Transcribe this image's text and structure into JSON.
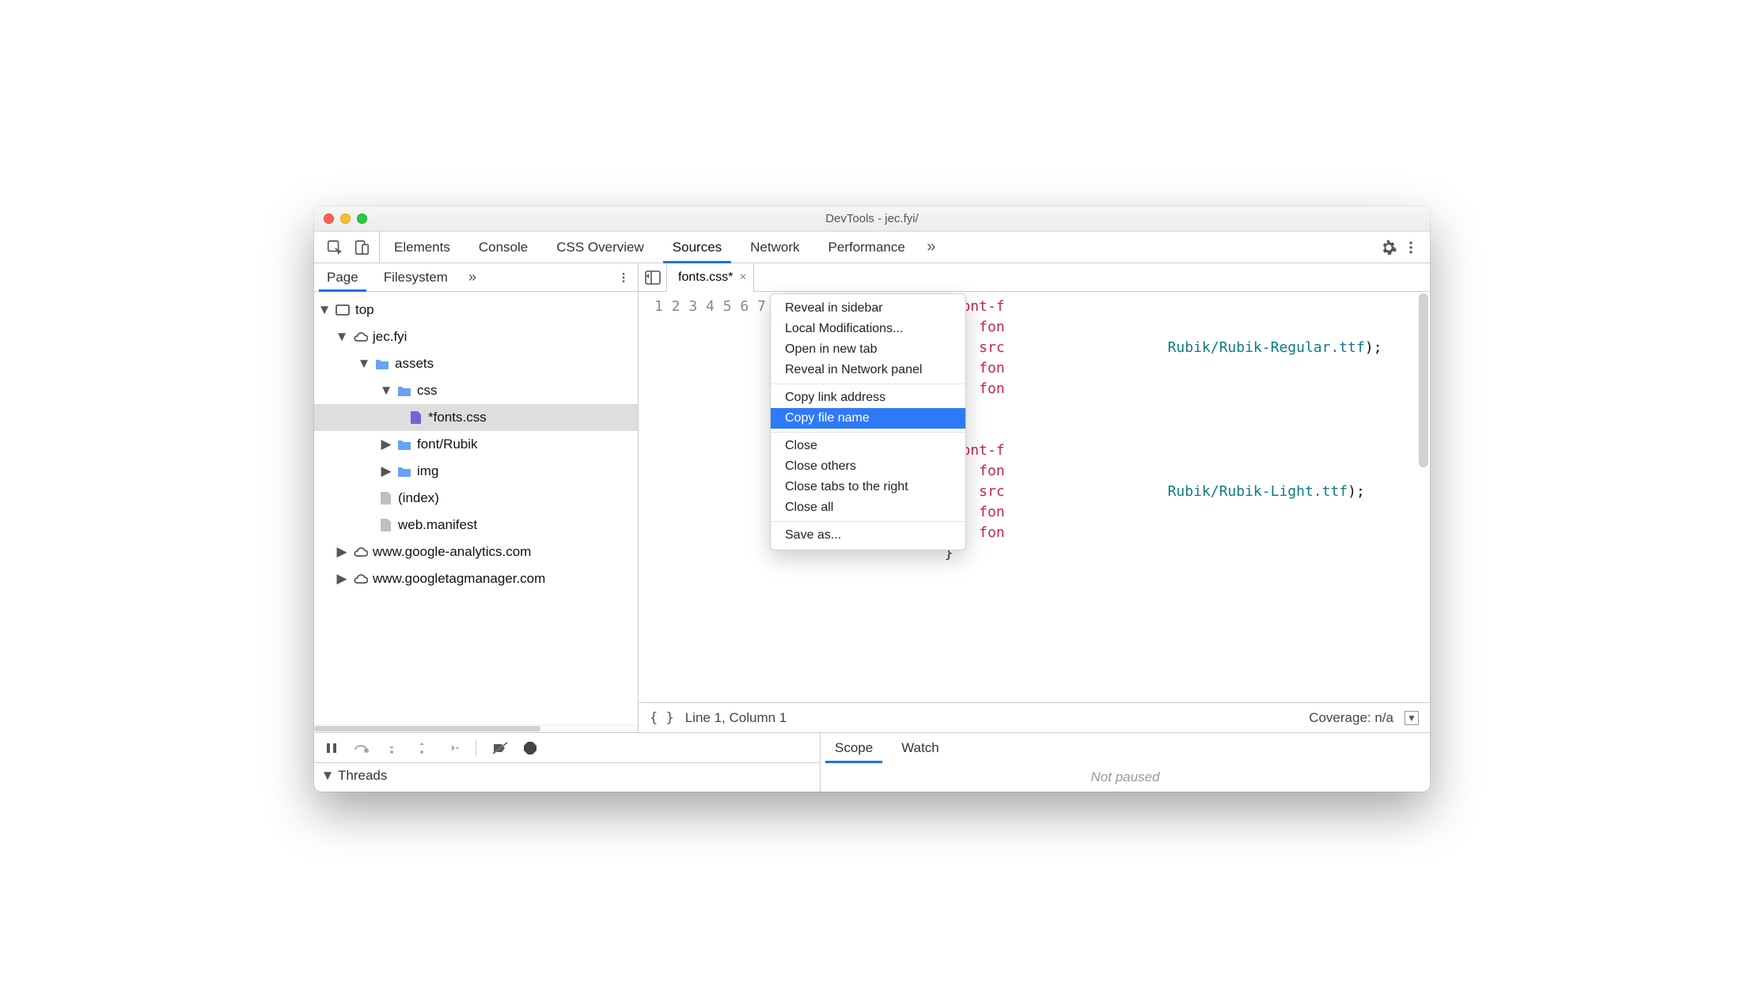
{
  "window": {
    "title": "DevTools - jec.fyi/"
  },
  "toolbar": {
    "tabs": [
      "Elements",
      "Console",
      "CSS Overview",
      "Sources",
      "Network",
      "Performance"
    ],
    "active": "Sources",
    "more": "»"
  },
  "sidebar": {
    "tabs": [
      "Page",
      "Filesystem"
    ],
    "active": "Page",
    "more": "»",
    "tree": {
      "top": "top",
      "domain": "jec.fyi",
      "folders": {
        "assets": "assets",
        "css": "css",
        "font": "font/Rubik",
        "img": "img"
      },
      "files": {
        "fonts_css": "*fonts.css",
        "index": "(index)",
        "manifest": "web.manifest"
      },
      "ext_domains": [
        "www.google-analytics.com",
        "www.googletagmanager.com"
      ]
    }
  },
  "editor": {
    "tab": "fonts.css*",
    "lines": [
      {
        "pre": "",
        "cls": "tok-atrule",
        "txt": "@font-f",
        "tail": ""
      },
      {
        "pre": "    ",
        "cls": "tok-prop",
        "txt": "fon",
        "tail": ""
      },
      {
        "pre": "    ",
        "cls": "tok-prop",
        "txt": "src",
        "tail_url": "Rubik/Rubik-Regular.ttf",
        "tail_close": ");"
      },
      {
        "pre": "    ",
        "cls": "tok-prop",
        "txt": "fon",
        "tail": ""
      },
      {
        "pre": "    ",
        "cls": "tok-prop",
        "txt": "fon",
        "tail": ""
      },
      {
        "pre": "",
        "cls": "tok-brace",
        "txt": "}",
        "tail": ""
      },
      {
        "pre": "",
        "cls": "",
        "txt": "",
        "tail": ""
      },
      {
        "pre": "",
        "cls": "tok-atrule",
        "txt": "@font-f",
        "tail": ""
      },
      {
        "pre": "    ",
        "cls": "tok-prop",
        "txt": "fon",
        "tail": ""
      },
      {
        "pre": "    ",
        "cls": "tok-prop",
        "txt": "src",
        "tail_url": "Rubik/Rubik-Light.ttf",
        "tail_close": ");"
      },
      {
        "pre": "    ",
        "cls": "tok-prop",
        "txt": "fon",
        "tail": ""
      },
      {
        "pre": "    ",
        "cls": "tok-prop",
        "txt": "fon",
        "tail": ""
      },
      {
        "pre": "",
        "cls": "tok-brace",
        "txt": "}",
        "tail": ""
      },
      {
        "pre": "",
        "cls": "",
        "txt": "",
        "tail": ""
      }
    ],
    "status": {
      "braces": "{ }",
      "pos": "Line 1, Column 1",
      "coverage": "Coverage: n/a"
    }
  },
  "context_menu": {
    "items": [
      "Reveal in sidebar",
      "Local Modifications...",
      "Open in new tab",
      "Reveal in Network panel",
      "-",
      "Copy link address",
      "Copy file name",
      "-",
      "Close",
      "Close others",
      "Close tabs to the right",
      "Close all",
      "-",
      "Save as..."
    ],
    "highlighted": "Copy file name"
  },
  "debug": {
    "threads": "Threads"
  },
  "right_pane": {
    "tabs": [
      "Scope",
      "Watch"
    ],
    "active": "Scope",
    "body": "Not paused"
  }
}
